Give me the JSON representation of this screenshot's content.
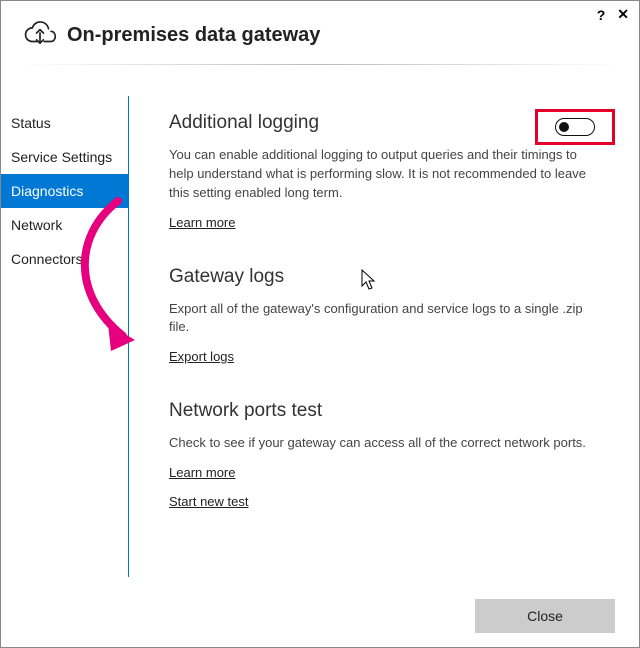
{
  "titlebar": {
    "help": "?",
    "close": "✕"
  },
  "header": {
    "title": "On-premises data gateway"
  },
  "sidebar": {
    "items": [
      {
        "label": "Status"
      },
      {
        "label": "Service Settings"
      },
      {
        "label": "Diagnostics"
      },
      {
        "label": "Network"
      },
      {
        "label": "Connectors"
      }
    ],
    "activeIndex": 2
  },
  "sections": {
    "logging": {
      "title": "Additional logging",
      "desc": "You can enable additional logging to output queries and their timings to help understand what is performing slow. It is not recommended to leave this setting enabled long term.",
      "link": "Learn more",
      "toggleOn": false
    },
    "gateway": {
      "title": "Gateway logs",
      "desc": "Export all of the gateway's configuration and service logs to a single .zip file.",
      "link": "Export logs"
    },
    "ports": {
      "title": "Network ports test",
      "desc": "Check to see if your gateway can access all of the correct network ports.",
      "link1": "Learn more",
      "link2": "Start new test"
    }
  },
  "footer": {
    "close": "Close"
  },
  "annotations": {
    "highlight_color": "#e4002b",
    "arrow_color": "#e6007e"
  }
}
